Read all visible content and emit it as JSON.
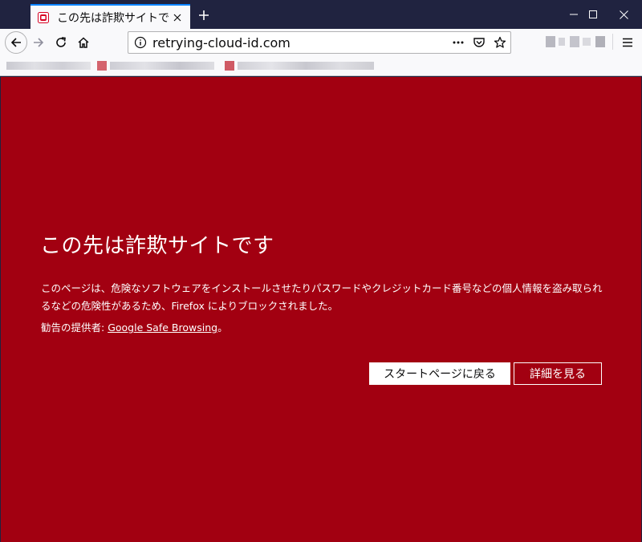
{
  "tab": {
    "title": "この先は詐欺サイトです",
    "favicon": "warning-favicon-icon",
    "close_icon": "close-icon"
  },
  "window": {
    "newtab_icon": "plus-icon",
    "minimize_icon": "minimize-icon",
    "maximize_icon": "maximize-icon",
    "close_icon": "close-icon"
  },
  "navbar": {
    "url": "retrying-cloud-id.com",
    "page_actions_icon": "more-icon",
    "pocket_icon": "pocket-icon",
    "bookmark_icon": "star-icon",
    "menu_icon": "hamburger-menu-icon"
  },
  "page": {
    "heading": "この先は詐欺サイトです",
    "description": "このページは、危険なソフトウェアをインストールさせたりパスワードやクレジットカード番号などの個人情報を盗み取られるなどの危険性があるため、Firefox によりブロックされました。",
    "advisory_prefix": "勧告の提供者: ",
    "advisory_link": "Google Safe Browsing",
    "advisory_suffix": "。",
    "back_button": "スタートページに戻る",
    "details_button": "詳細を見る"
  },
  "colors": {
    "page_background": "#a20011",
    "titlebar": "#202340",
    "toolbar": "#f9f9fb",
    "tab_accent": "#0a84ff"
  }
}
